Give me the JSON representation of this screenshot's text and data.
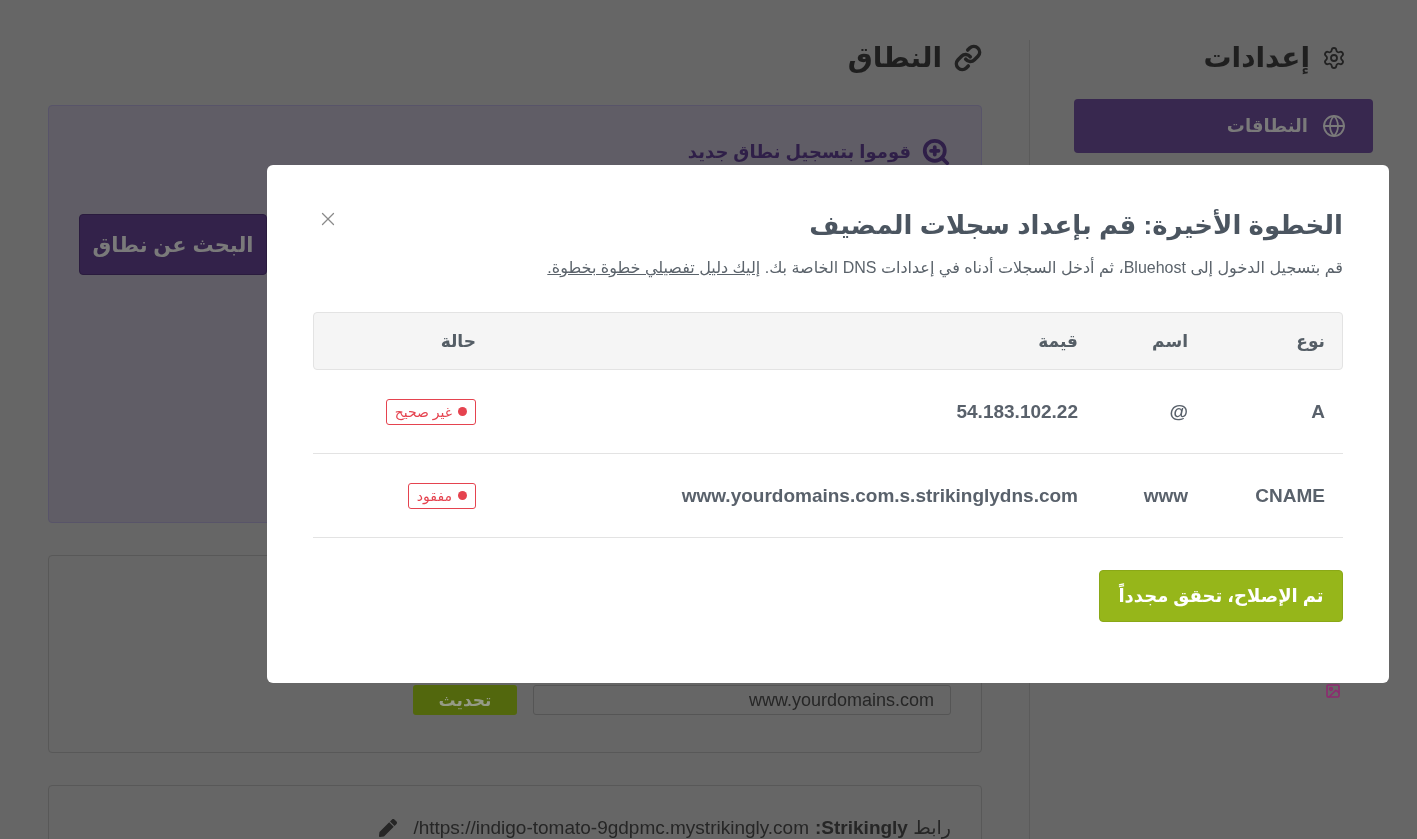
{
  "sidebar": {
    "title": "إعدادات",
    "items": [
      {
        "label": "النطاقات",
        "selected": true
      }
    ]
  },
  "main": {
    "title": "النطاق",
    "register_card": {
      "heading": "قوموا بتسجيل نطاق جديد",
      "search_button": "البحث عن نطاق"
    },
    "custom_domain_card": {
      "domain_field": {
        "value": "www.yourdomains.com"
      },
      "update_button": "تحديث"
    },
    "site_link_card": {
      "label": "رابط **Strikingly:**",
      "url": "https://indigo-tomato-9gdpmc.mystrikingly.com/"
    }
  },
  "dialog": {
    "title": "الخطوة الأخيرة: قم بإعداد سجلات المضيف",
    "description": {
      "text": "قم بتسجيل الدخول إلى Bluehost، ثم أدخل السجلات أدناه في إعدادات DNS الخاصة بك.",
      "link": "إليك دليل تفصيلي خطوة بخطوة."
    },
    "records_table": {
      "columns": [
        "نوع",
        "اسم",
        "قيمة",
        "حالة"
      ],
      "rows": [
        {
          "type": "A",
          "name": "@",
          "value": "54.183.102.22",
          "status": "غير صحيح"
        },
        {
          "type": "CNAME",
          "name": "www",
          "value": "www.yourdomains.com.s.strikinglydns.com",
          "status": "مفقود"
        }
      ]
    },
    "confirm_button": "تم الإصلاح، تحقق مجدداً"
  }
}
